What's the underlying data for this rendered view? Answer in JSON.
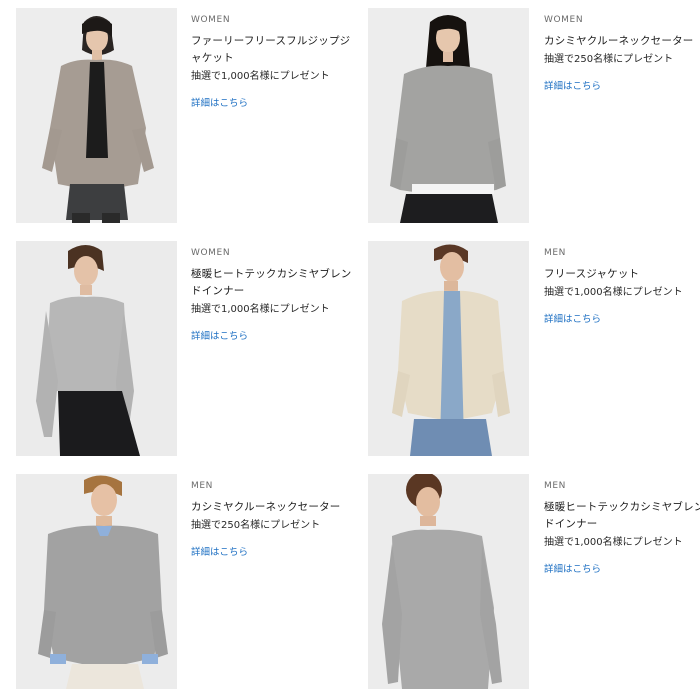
{
  "products": [
    {
      "category": "WOMEN",
      "title": "ファーリーフリースフルジップジャケット",
      "gift": "抽選で1,000名様にプレゼント",
      "link": "詳細はこちら",
      "image": "woman-in-fleece-jacket"
    },
    {
      "category": "WOMEN",
      "title": "カシミヤクルーネックセーター",
      "gift": "抽選で250名様にプレゼント",
      "link": "詳細はこちら",
      "image": "woman-in-cashmere-sweater"
    },
    {
      "category": "WOMEN",
      "title": "極暖ヒートテックカシミヤブレンドインナー",
      "gift": "抽選で1,000名様にプレゼント",
      "link": "詳細はこちら",
      "image": "woman-in-heattech-top"
    },
    {
      "category": "MEN",
      "title": "フリースジャケット",
      "gift": "抽選で1,000名様にプレゼント",
      "link": "詳細はこちら",
      "image": "man-in-fleece-jacket"
    },
    {
      "category": "MEN",
      "title": "カシミヤクルーネックセーター",
      "gift": "抽選で250名様にプレゼント",
      "link": "詳細はこちら",
      "image": "man-in-cashmere-sweater"
    },
    {
      "category": "MEN",
      "title": "極暖ヒートテックカシミヤブレンドインナー",
      "gift": "抽選で1,000名様にプレゼント",
      "link": "詳細はこちら",
      "image": "man-in-heattech-top"
    }
  ],
  "colors": {
    "link": "#1b6ec2",
    "category": "#6b6b6b",
    "photo_bg": "#ececec"
  }
}
